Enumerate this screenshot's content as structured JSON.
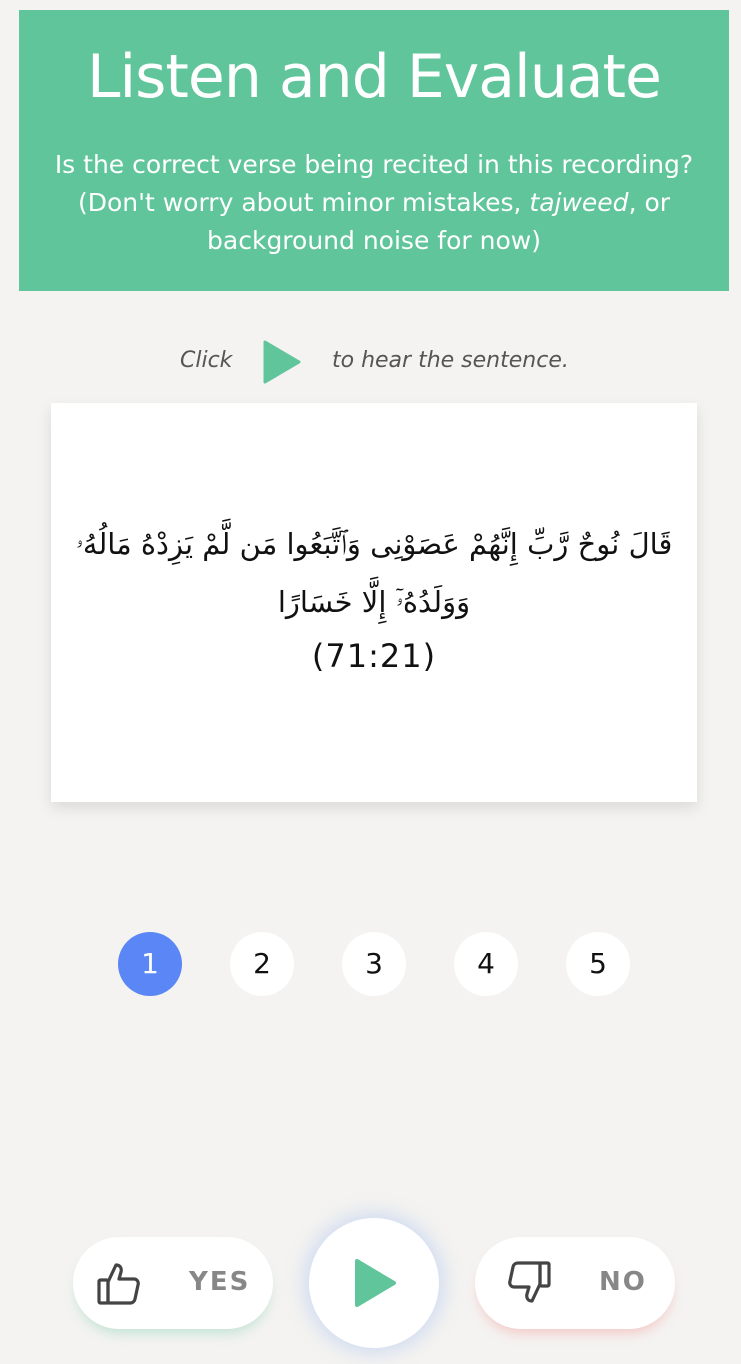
{
  "header": {
    "title": "Listen and Evaluate",
    "subtitle_part1": "Is the correct verse being recited in this recording? (Don't worry about minor mistakes, ",
    "subtitle_em": "tajweed",
    "subtitle_part2": ", or background noise for now)"
  },
  "hint": {
    "click_label": "Click",
    "rest_label": "to hear the sentence.",
    "icon": "play-icon"
  },
  "verse": {
    "arabic": "قَالَ نُوحٌ رَّبِّ إِنَّهُمْ عَصَوْنِى وَٱتَّبَعُوا مَن لَّمْ يَزِدْهُ مَالُهُۥ وَوَلَدُهُۥٓ إِلَّا خَسَارًا",
    "reference": "(71:21)"
  },
  "pagination": {
    "pages": [
      "1",
      "2",
      "3",
      "4",
      "5"
    ],
    "active": "1"
  },
  "actions": {
    "yes_label": "YES",
    "no_label": "NO",
    "yes_icon": "thumbs-up-icon",
    "no_icon": "thumbs-down-icon",
    "play_icon": "play-icon"
  },
  "colors": {
    "header_bg": "#61c59b",
    "accent_green": "#61c59b",
    "active_page": "#5a87f5",
    "background": "#f4f3f1"
  }
}
